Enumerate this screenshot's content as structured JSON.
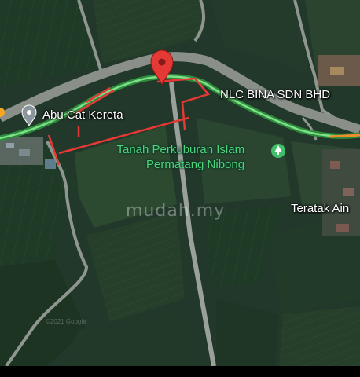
{
  "map": {
    "type": "satellite",
    "pin_color": "#e53935",
    "route_color": "#4caf50",
    "boundary_color": "#e53935",
    "places": [
      {
        "name": "Abu Cat Kereta",
        "icon": "place-pin-icon"
      },
      {
        "name": "NLC BINA SDN BHD",
        "icon": "none"
      },
      {
        "name_line1": "Tanah Perkuburan Islam",
        "name_line2": "Permatang Nibong",
        "icon": "tree-icon"
      },
      {
        "name": "Teratak Ain",
        "icon": "none"
      }
    ],
    "watermark": "mudah.my",
    "copyright": "©2021 Google"
  }
}
